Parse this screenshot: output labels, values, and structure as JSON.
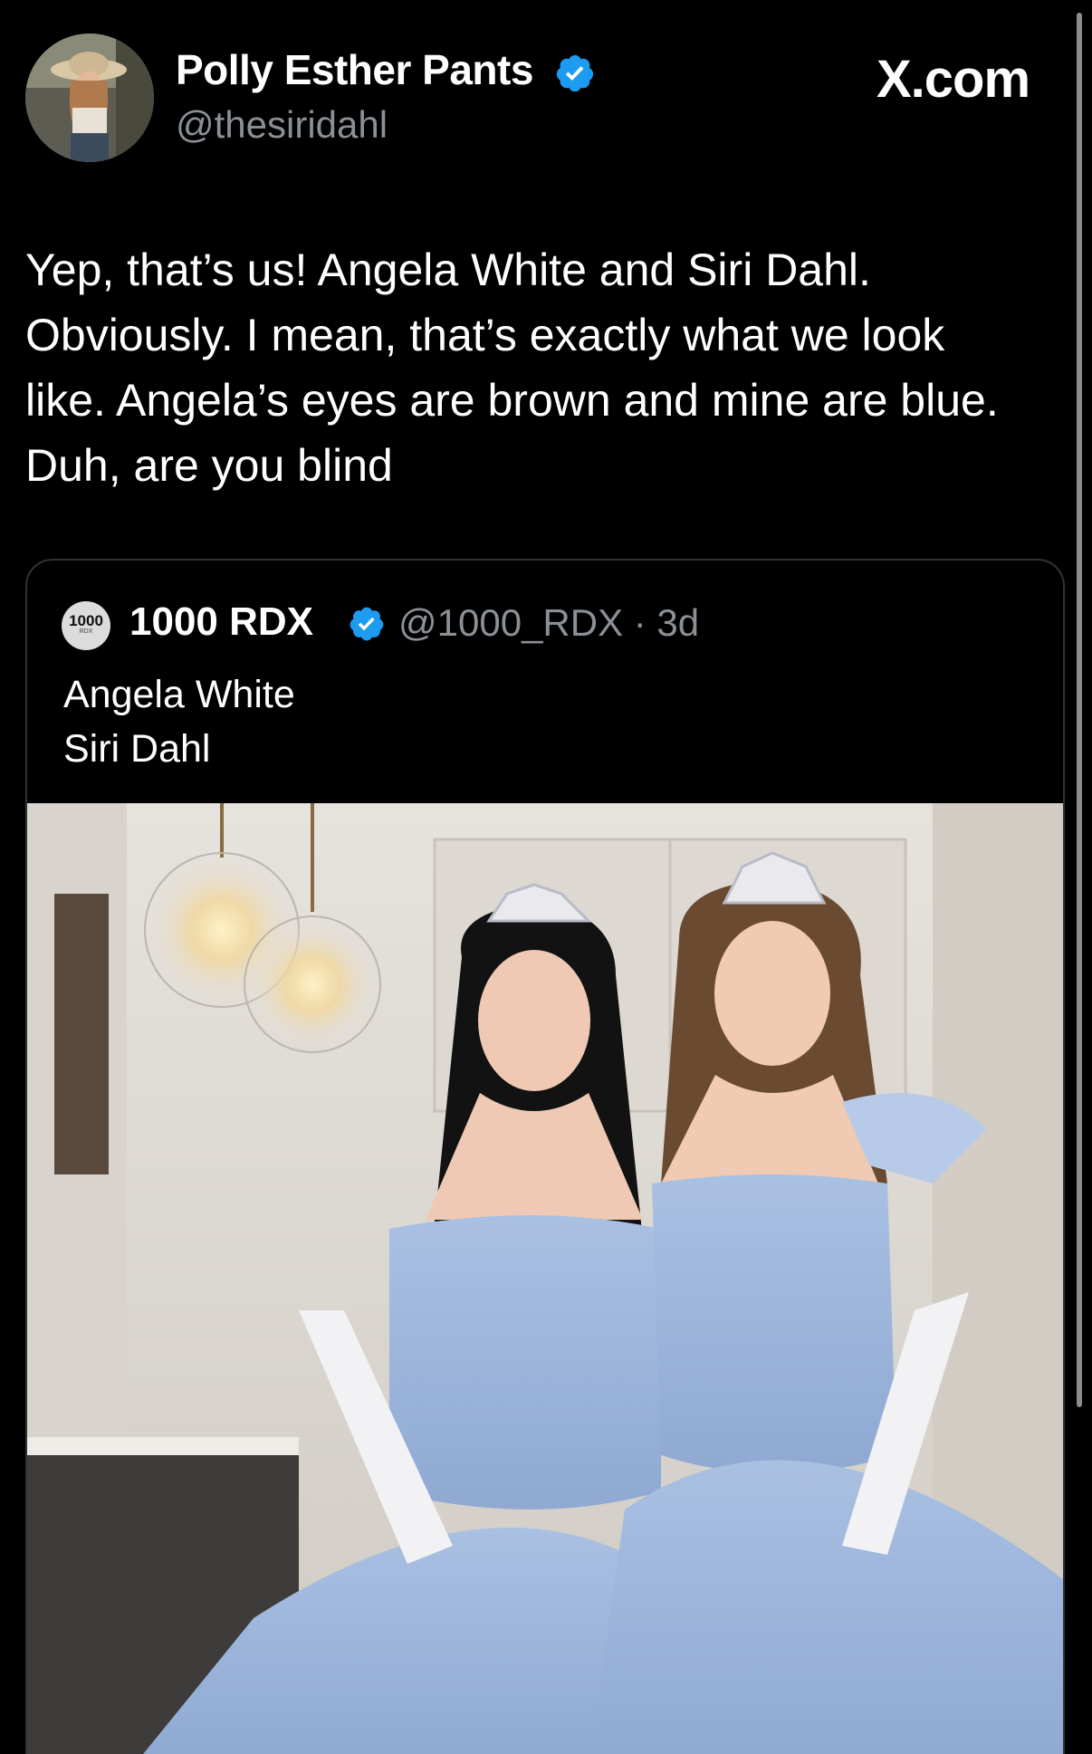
{
  "post": {
    "author_name": "Polly Esther Pants",
    "author_handle": "@thesiridahl",
    "site_label": "X.com",
    "text_lines": [
      "Yep, that’s us! Angela White and Siri Dahl.",
      "Obviously. I mean, that’s exactly what we look",
      "like. Angela’s eyes are brown and mine are blue.",
      "Duh, are you blind"
    ]
  },
  "quote": {
    "logo_text": "1000",
    "logo_subtext": "RDX",
    "author_name": "1000 RDX",
    "meta": "@1000_RDX · 3d",
    "text_lines": [
      "Angela White",
      "Siri Dahl"
    ]
  },
  "colors": {
    "background": "#000000",
    "text": "#ffffff",
    "muted": "#8b9096",
    "verified": "#1d9bf0",
    "card_border": "#2f3336"
  },
  "icons": {
    "verified": "verified-badge-icon"
  }
}
